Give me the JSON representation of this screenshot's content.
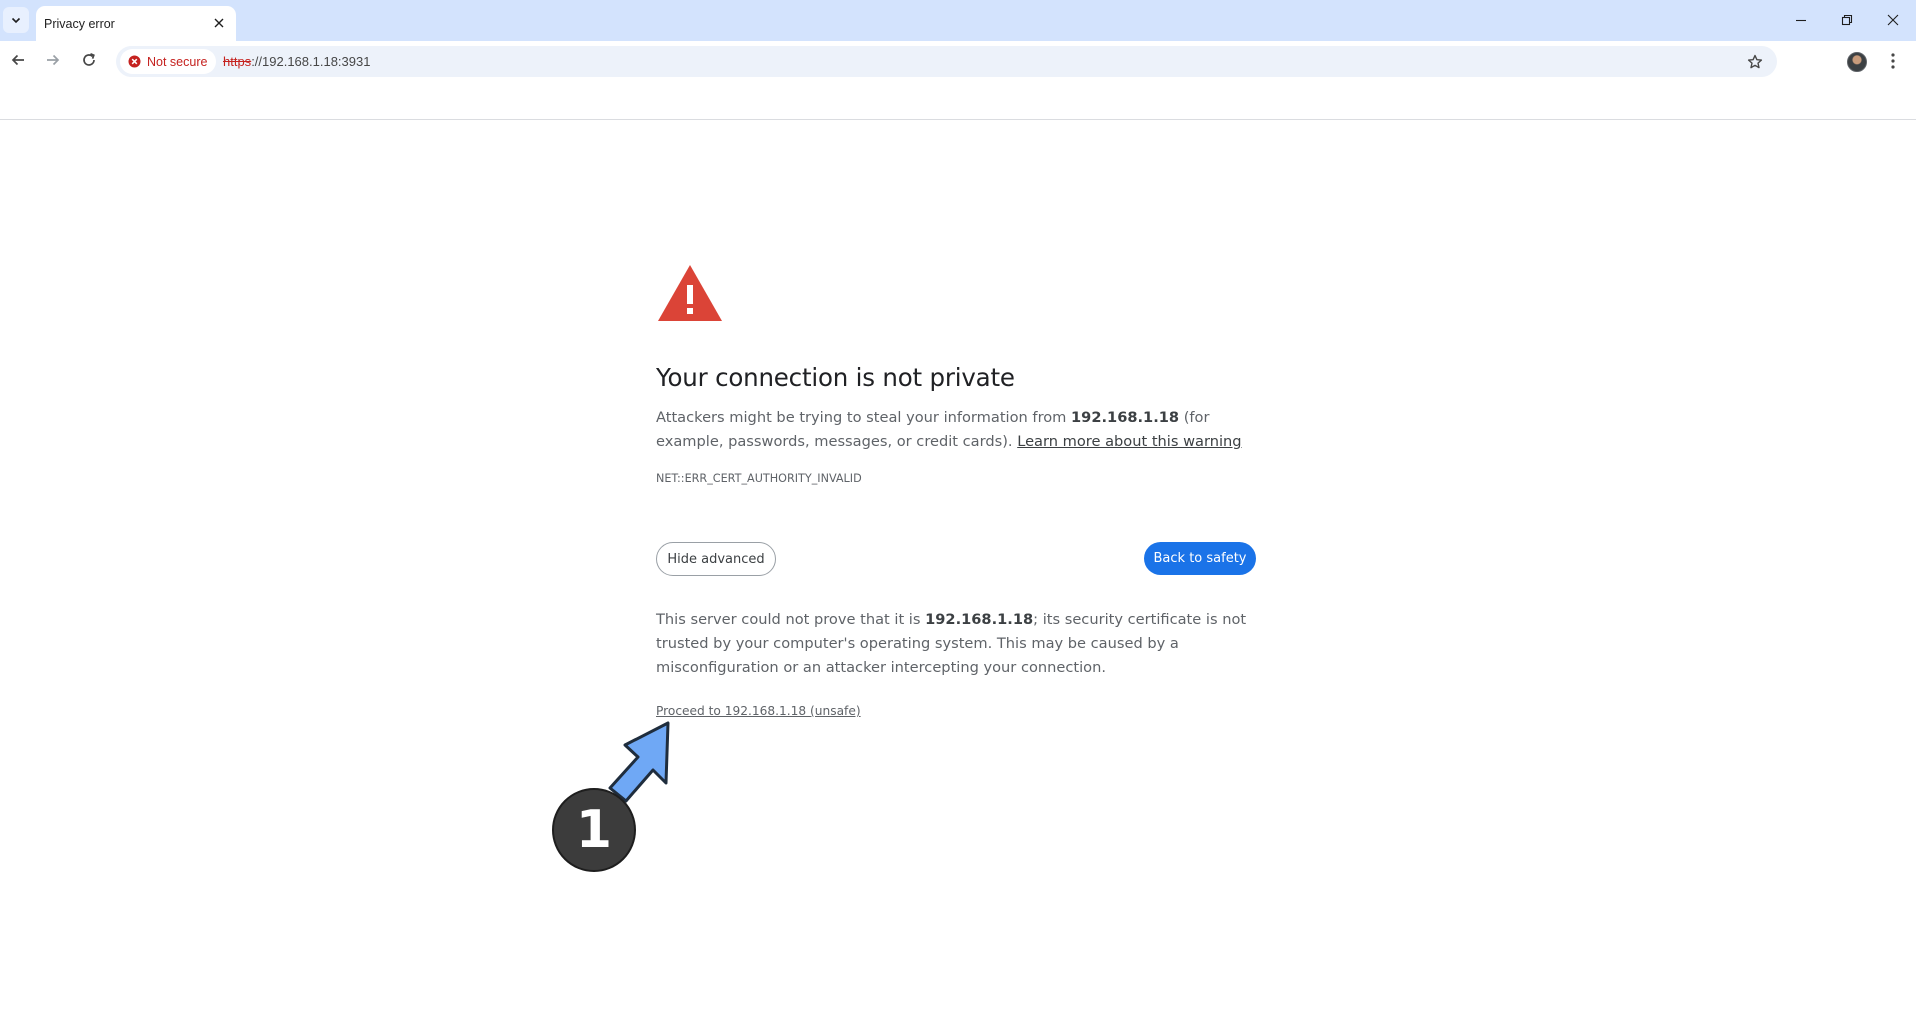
{
  "browser": {
    "tab": {
      "title": "Privacy error"
    },
    "security_chip": {
      "label": "Not secure"
    },
    "url": {
      "scheme": "https",
      "rest": "://192.168.1.18:3931"
    },
    "icons": {
      "tab_search": "chevron-down-icon",
      "tab_close": "close-icon",
      "back": "arrow-left-icon",
      "forward": "arrow-right-icon",
      "reload": "reload-icon",
      "security": "error-circle-icon",
      "bookmark": "star-icon",
      "menu": "three-dots-icon",
      "minimize": "minimize-icon",
      "restore": "restore-icon",
      "close_window": "close-icon"
    },
    "colors": {
      "tabstrip": "#d3e3fd",
      "omnibox": "#edf2fa",
      "danger": "#c5221f"
    }
  },
  "interstitial": {
    "heading": "Your connection is not private",
    "intro": {
      "part1": "Attackers might be trying to steal your information from ",
      "host": "192.168.1.18",
      "part2": " (for example, passwords, messages, or credit cards). ",
      "learn_more": "Learn more about this warning"
    },
    "error_code": "NET::ERR_CERT_AUTHORITY_INVALID",
    "hide_advanced_label": "Hide advanced",
    "back_to_safety_label": "Back to safety",
    "details": {
      "part1": "This server could not prove that it is ",
      "host": "192.168.1.18",
      "part2": "; its security certificate is not trusted by your computer's operating system. This may be caused by a misconfiguration or an attacker intercepting your connection."
    },
    "proceed_link": "Proceed to 192.168.1.18 (unsafe)",
    "colors": {
      "warning_red": "#db4437",
      "primary_blue": "#1a73e8"
    }
  },
  "annotation": {
    "step_number": "1",
    "arrow_color": "#6fa8f5"
  }
}
